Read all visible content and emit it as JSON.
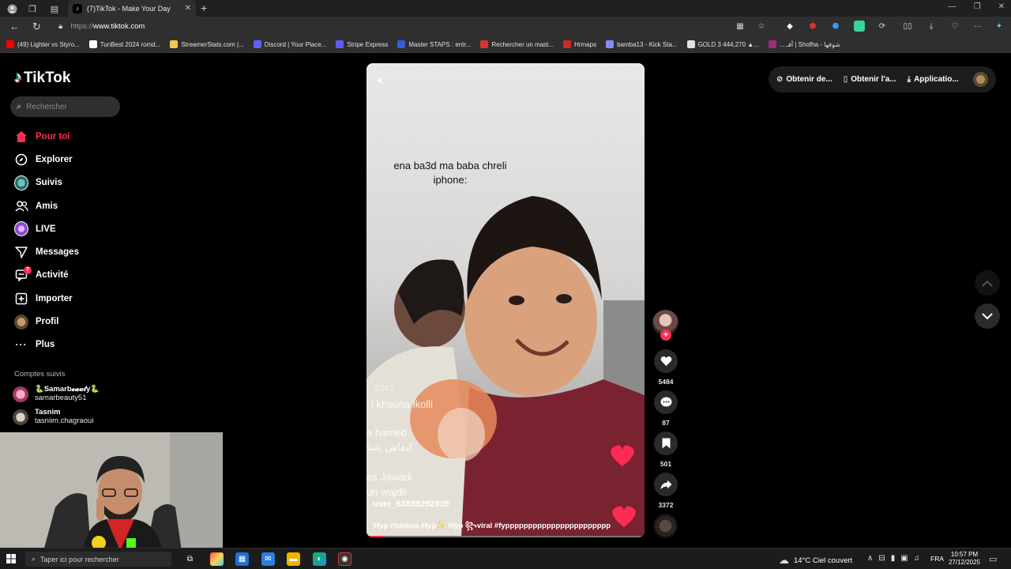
{
  "browser": {
    "tab": {
      "title": "(7)TikTok - Make Your Day",
      "close": "✕"
    },
    "new_tab": "+",
    "window_controls": [
      "—",
      "❐",
      "✕"
    ],
    "url": {
      "protocol": "https://",
      "host": "www.tiktok.com"
    },
    "bookmarks": [
      {
        "label": "(49) Lighter vs Styro...",
        "color": "#ff0000"
      },
      {
        "label": "TunBest 2024 romd...",
        "color": "#ffffff"
      },
      {
        "label": "StreamerStats.com |...",
        "color": "#f2c94c"
      },
      {
        "label": "Discord | Your Place...",
        "color": "#5865f2"
      },
      {
        "label": "Stripe Express",
        "color": "#635bff"
      },
      {
        "label": "Master STAPS : entr...",
        "color": "#3b5bdb"
      },
      {
        "label": "Rechercher un mast...",
        "color": "#e03131"
      },
      {
        "label": "Hrmaps",
        "color": "#c92a2a"
      },
      {
        "label": "bamba13 - Kick Sta...",
        "color": "#8a8aff"
      },
      {
        "label": "GOLD 3 444,270 ▲...",
        "color": "#e0e0e0"
      },
      {
        "label": "... أفـ | Shofha - شوفها",
        "color": "#9c2b7a"
      }
    ]
  },
  "sidebar": {
    "logo": "TikTok",
    "search_placeholder": "Rechercher",
    "items": [
      {
        "label": "Pour toi",
        "icon": "home-icon",
        "glyph": "⌂"
      },
      {
        "label": "Explorer",
        "icon": "compass-icon",
        "glyph": "◎"
      },
      {
        "label": "Suivis",
        "icon": "avatar",
        "glyph": ""
      },
      {
        "label": "Amis",
        "icon": "friends-icon",
        "glyph": "⚇"
      },
      {
        "label": "LIVE",
        "icon": "live-icon",
        "glyph": ""
      },
      {
        "label": "Messages",
        "icon": "send-icon",
        "glyph": "➤"
      },
      {
        "label": "Activité",
        "icon": "inbox-icon",
        "glyph": "▭",
        "badge": "7"
      },
      {
        "label": "Importer",
        "icon": "plus-square-icon",
        "glyph": "⊞"
      },
      {
        "label": "Profil",
        "icon": "avatar",
        "glyph": ""
      },
      {
        "label": "Plus",
        "icon": "more-icon",
        "glyph": "···"
      }
    ],
    "followed_title": "Comptes suivis",
    "followed": [
      {
        "name": "🐍Samarb𝓮𝓪𝓊𝓉y🐍",
        "handle": "samarbeauty51"
      },
      {
        "name": "Tasnim",
        "handle": "tasniim.chagraoui"
      }
    ]
  },
  "video": {
    "caption": "ena ba3d ma baba chreli iphone:",
    "username": "user_63839292939",
    "hashtags": "#fyp #tunisia #fyp✨ #fyp ꧂viral #fyppppppppppppppppppppppp",
    "progress": 0.06
  },
  "actions": {
    "likes": "5484",
    "comments": "87",
    "saves": "501",
    "shares": "3372"
  },
  "topbar": {
    "coins": "Obtenir de...",
    "app": "Obtenir l'a...",
    "desktop": "Applicatio..."
  },
  "taskbar": {
    "search_placeholder": "Taper ici pour rechercher",
    "weather": "14°C  Ciel couvert",
    "language": "FRA",
    "time": "10:57 PM",
    "date": "27/12/2025"
  },
  "colors": {
    "accent": "#fe2c55",
    "chrome": "#2f2f2f",
    "page": "#000000"
  }
}
